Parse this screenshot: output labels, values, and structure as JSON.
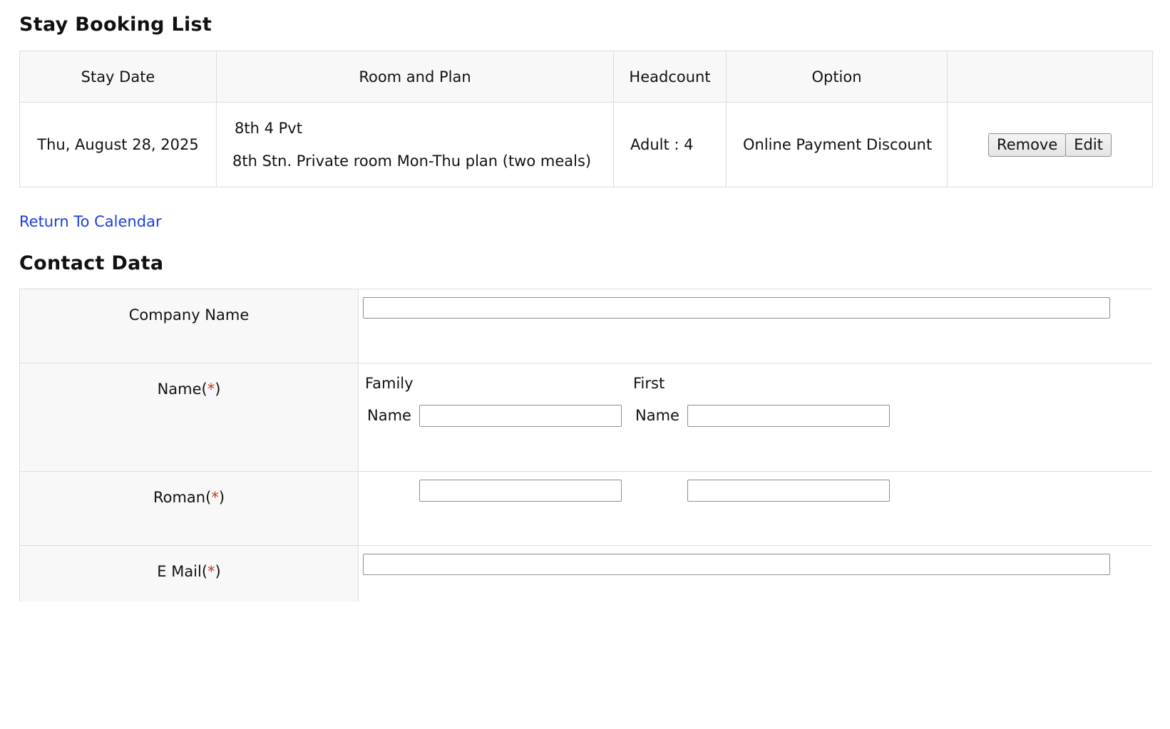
{
  "booking_section": {
    "title": "Stay Booking List",
    "columns": {
      "stay_date": "Stay Date",
      "room_and_plan": "Room and Plan",
      "headcount": "Headcount",
      "option": "Option",
      "actions": ""
    },
    "rows": [
      {
        "stay_date": "Thu, August 28, 2025",
        "room": "8th 4 Pvt",
        "plan": "8th Stn. Private room Mon-Thu plan (two meals)",
        "headcount": "Adult : 4",
        "option": "Online Payment Discount",
        "remove_label": "Remove",
        "edit_label": "Edit"
      }
    ]
  },
  "return_link": "Return To Calendar",
  "contact_section": {
    "title": "Contact Data",
    "company_label": "Company Name",
    "name_label": "Name(",
    "roman_label": "Roman(",
    "email_label": "E Mail(",
    "required_mark": "*",
    "label_close": ")",
    "family_label": "Family",
    "first_label": "First",
    "name_sub_label": "Name",
    "company_value": "",
    "family_name_value": "",
    "first_name_value": "",
    "roman_family_value": "",
    "roman_first_value": "",
    "email_value": ""
  },
  "colors": {
    "link": "#1a3fe0",
    "required": "#c0391b",
    "header_bg": "#f8f8f8",
    "border": "#dcdcdc"
  }
}
